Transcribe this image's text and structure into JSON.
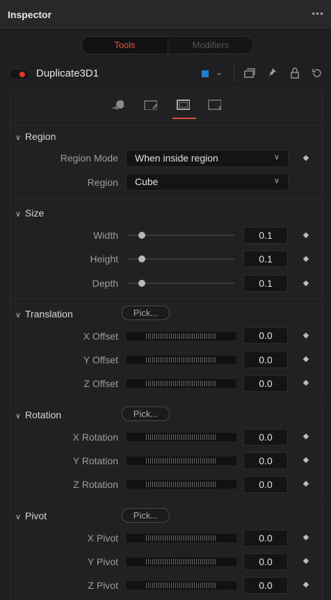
{
  "panel": {
    "title": "Inspector",
    "more": "•••"
  },
  "tabs": [
    {
      "label": "Tools",
      "active": true
    },
    {
      "label": "Modifiers",
      "active": false
    }
  ],
  "tool": {
    "name": "Duplicate3D1",
    "color": "#1d7fd2",
    "enabled_color": "#e2372c"
  },
  "icons": {
    "chevron": "⌄",
    "views": "❐",
    "pin": "⌖",
    "lock": "⌂",
    "reset": "↺"
  },
  "sections": {
    "region": {
      "title": "Region",
      "mode_label": "Region Mode",
      "mode_value": "When inside region",
      "region_label": "Region",
      "region_value": "Cube"
    },
    "size": {
      "title": "Size",
      "rows": [
        {
          "label": "Width",
          "value": "0.1"
        },
        {
          "label": "Height",
          "value": "0.1"
        },
        {
          "label": "Depth",
          "value": "0.1"
        }
      ]
    },
    "translation": {
      "title": "Translation",
      "pick": "Pick...",
      "rows": [
        {
          "label": "X Offset",
          "value": "0.0"
        },
        {
          "label": "Y Offset",
          "value": "0.0"
        },
        {
          "label": "Z Offset",
          "value": "0.0"
        }
      ]
    },
    "rotation": {
      "title": "Rotation",
      "pick": "Pick...",
      "rows": [
        {
          "label": "X Rotation",
          "value": "0.0"
        },
        {
          "label": "Y Rotation",
          "value": "0.0"
        },
        {
          "label": "Z Rotation",
          "value": "0.0"
        }
      ]
    },
    "pivot": {
      "title": "Pivot",
      "pick": "Pick...",
      "rows": [
        {
          "label": "X Pivot",
          "value": "0.0"
        },
        {
          "label": "Y Pivot",
          "value": "0.0"
        },
        {
          "label": "Z Pivot",
          "value": "0.0"
        }
      ]
    }
  }
}
